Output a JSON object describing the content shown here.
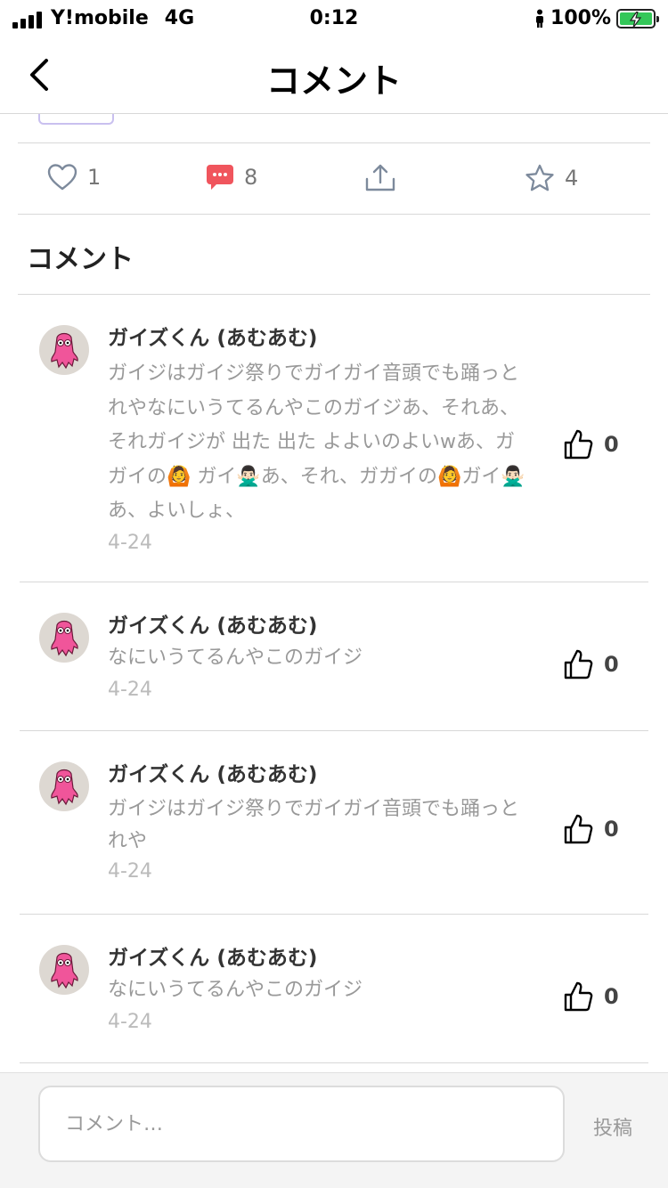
{
  "status_bar": {
    "carrier": "Y!mobile",
    "network": "4G",
    "time": "0:12",
    "battery_percent": "100%",
    "battery_color": "#34c759"
  },
  "nav": {
    "title": "コメント",
    "back_icon": "chevron-left-icon"
  },
  "actions": {
    "likes": "1",
    "comments": "8",
    "favorites": "4",
    "comment_icon_color": "#f0555d"
  },
  "section": {
    "title": "コメント"
  },
  "comments": [
    {
      "author": "ガイズくん (あむあむ)",
      "text": "ガイジはガイジ祭りでガイガイ音頭でも踊っとれやなにいうてるんやこのガイジあ、それあ、それガイジが 出た 出た よよいのよいwあ、ガガイの🙆 ガイ🙅🏻‍♂️あ、それ、ガガイの🙆ガイ🙅🏻‍♂️あ、よいしょ、",
      "date": "4-24",
      "likes": "0"
    },
    {
      "author": "ガイズくん (あむあむ)",
      "text": "なにいうてるんやこのガイジ",
      "date": "4-24",
      "likes": "0"
    },
    {
      "author": "ガイズくん (あむあむ)",
      "text": "ガイジはガイジ祭りでガイガイ音頭でも踊っとれや",
      "date": "4-24",
      "likes": "0"
    },
    {
      "author": "ガイズくん (あむあむ)",
      "text": "なにいうてるんやこのガイジ",
      "date": "4-24",
      "likes": "0"
    }
  ],
  "composer": {
    "placeholder": "コメント…",
    "post_label": "投稿"
  }
}
